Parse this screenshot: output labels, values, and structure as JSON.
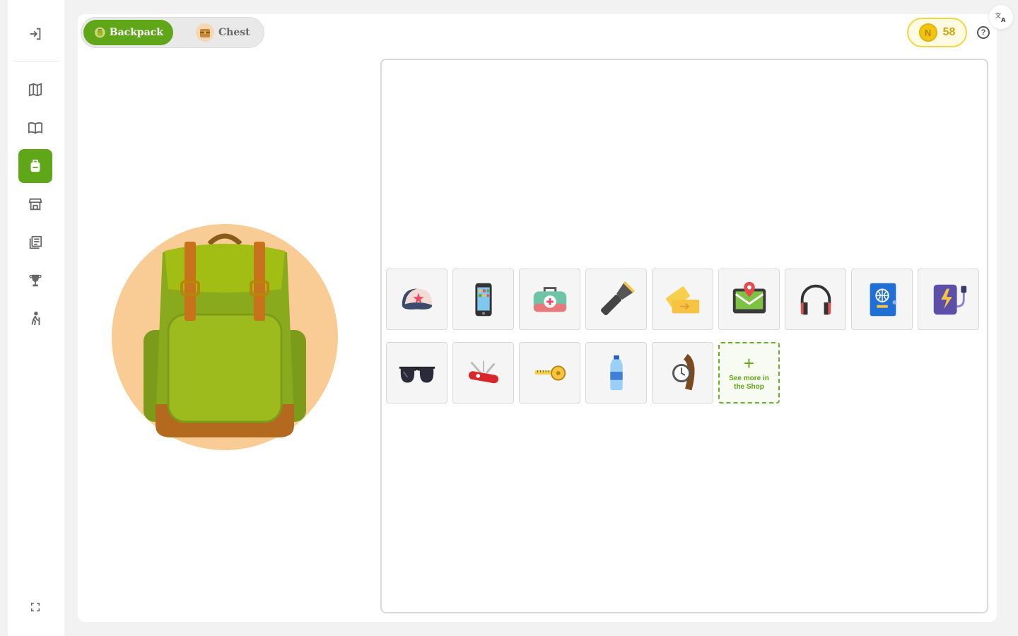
{
  "tabs": {
    "backpack_label": "Backpack",
    "chest_label": "Chest"
  },
  "coins": {
    "value": "58",
    "symbol": "N"
  },
  "help": {
    "glyph": "?"
  },
  "sidebar": {
    "items": [
      {
        "name": "logout-icon"
      },
      {
        "name": "map-icon"
      },
      {
        "name": "book-icon"
      },
      {
        "name": "backpack-icon",
        "active": true
      },
      {
        "name": "shop-icon"
      },
      {
        "name": "library-icon"
      },
      {
        "name": "trophy-icon"
      },
      {
        "name": "hiker-icon"
      },
      {
        "name": "fullscreen-icon"
      }
    ]
  },
  "items": [
    {
      "name": "cap-icon"
    },
    {
      "name": "smartphone-icon"
    },
    {
      "name": "first-aid-kit-icon"
    },
    {
      "name": "flashlight-icon"
    },
    {
      "name": "tickets-icon"
    },
    {
      "name": "map-tablet-icon"
    },
    {
      "name": "headphones-icon"
    },
    {
      "name": "passport-icon"
    },
    {
      "name": "power-bank-icon"
    },
    {
      "name": "sunglasses-icon"
    },
    {
      "name": "swiss-knife-icon"
    },
    {
      "name": "measuring-tape-icon"
    },
    {
      "name": "water-bottle-icon"
    },
    {
      "name": "watch-icon"
    }
  ],
  "shop_card": {
    "plus": "+",
    "label": "See more in the Shop"
  },
  "colors": {
    "accent": "#5fa619",
    "coin": "#f1c40f",
    "bag_bg": "#f8cc94"
  }
}
